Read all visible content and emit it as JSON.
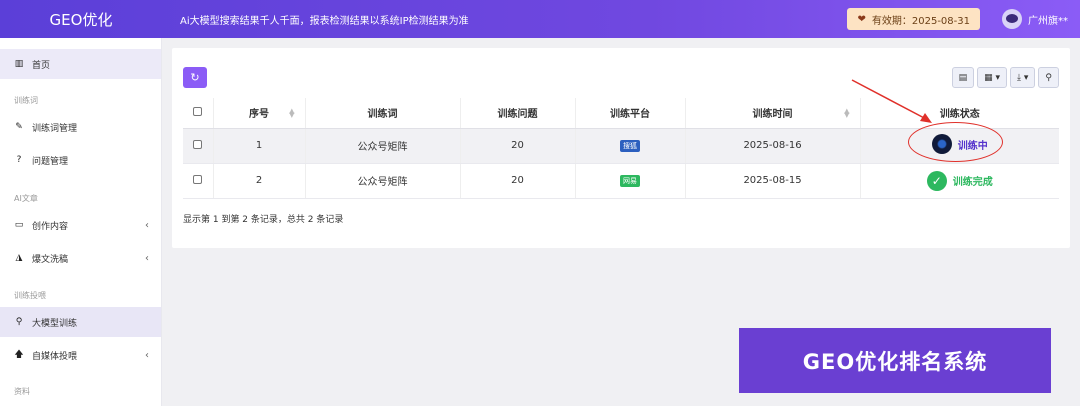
{
  "header": {
    "brand": "GEO优化",
    "slogan": "Ai大模型搜索结果千人千面，报表检测结果以系统IP检测结果为准",
    "expiry": "有效期：2025-08-31",
    "user": "广州旗**"
  },
  "sidebar": {
    "home": "首页",
    "group_words": "训练词",
    "word_manage": "训练词管理",
    "question_manage": "问题管理",
    "group_article": "AI文章",
    "create_content": "创作内容",
    "viral_wash": "爆文洗稿",
    "group_feed": "训练投喂",
    "model_train": "大模型训练",
    "media_feed": "自媒体投喂",
    "group_data": "资料"
  },
  "table": {
    "headers": [
      "序号",
      "训练词",
      "训练问题",
      "训练平台",
      "训练时间",
      "训练状态"
    ],
    "rows": [
      {
        "index": "1",
        "word": "公众号矩阵",
        "question": "20",
        "platform": "搜狐",
        "platform_color": "#2c5fbf",
        "time": "2025-08-16",
        "status": "训练中"
      },
      {
        "index": "2",
        "word": "公众号矩阵",
        "question": "20",
        "platform": "网易",
        "platform_color": "#2db85f",
        "time": "2025-08-15",
        "status": "训练完成"
      }
    ],
    "summary": "显示第 1 到第 2 条记录，总共 2 条记录"
  },
  "promo": "GEO优化排名系统"
}
